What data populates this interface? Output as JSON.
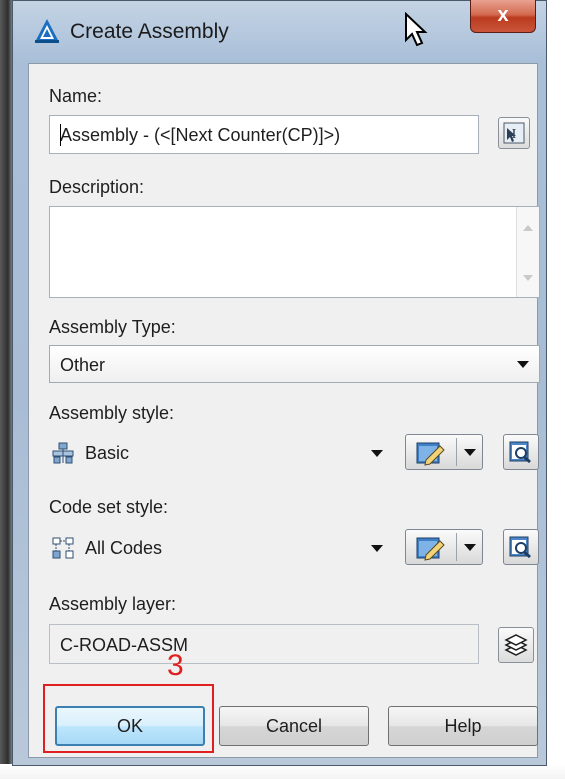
{
  "window": {
    "title": "Create Assembly",
    "close_label": "x"
  },
  "fields": {
    "name_label": "Name:",
    "name_value": "Assembly - (<[Next Counter(CP)]>)",
    "description_label": "Description:",
    "description_value": "",
    "assembly_type_label": "Assembly Type:",
    "assembly_type_value": "Other",
    "assembly_style_label": "Assembly style:",
    "assembly_style_value": "Basic",
    "code_set_style_label": "Code set style:",
    "code_set_style_value": "All Codes",
    "assembly_layer_label": "Assembly layer:",
    "assembly_layer_value": "C-ROAD-ASSM"
  },
  "buttons": {
    "ok_label": "OK",
    "cancel_label": "Cancel",
    "help_label": "Help"
  },
  "annotation": {
    "number": "3",
    "color": "#e02020"
  },
  "colors": {
    "title_bar": "#a9bfd8",
    "default_button_border": "#3c7fb1",
    "close_button": "#c9553a"
  }
}
